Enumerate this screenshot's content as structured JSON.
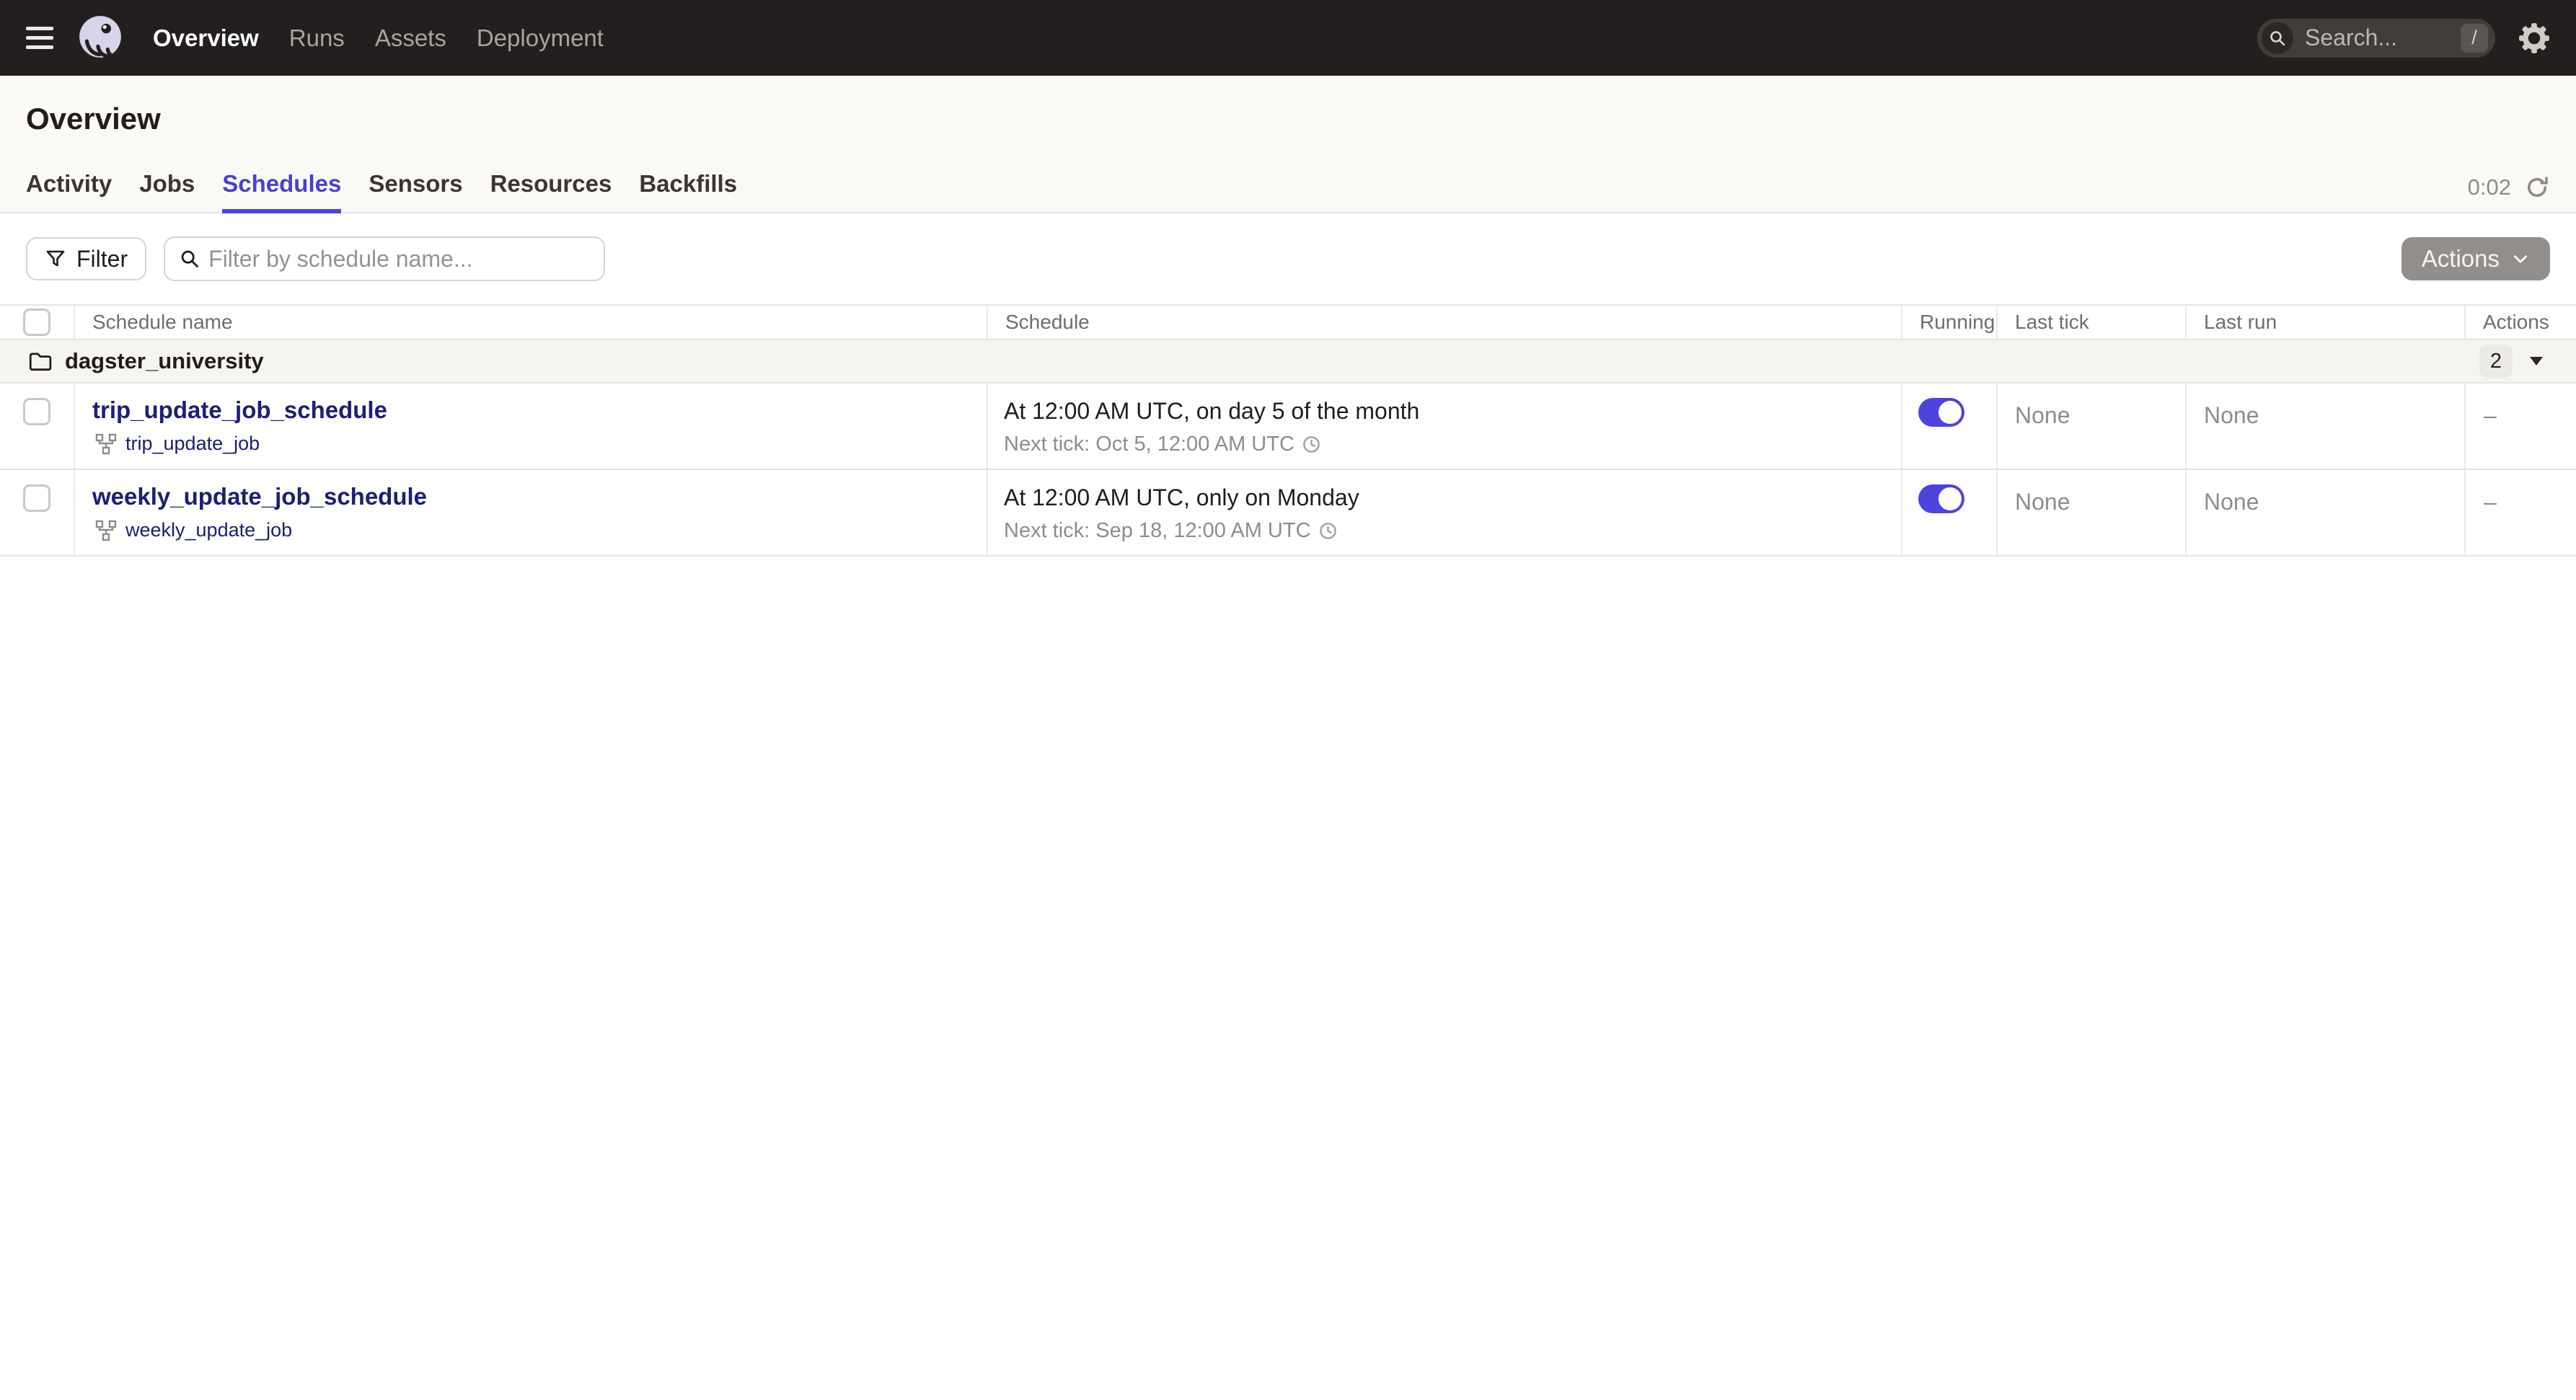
{
  "topbar": {
    "nav": [
      {
        "label": "Overview",
        "active": true
      },
      {
        "label": "Runs",
        "active": false
      },
      {
        "label": "Assets",
        "active": false
      },
      {
        "label": "Deployment",
        "active": false
      }
    ],
    "search": {
      "placeholder": "Search...",
      "shortcut": "/"
    }
  },
  "page": {
    "title": "Overview"
  },
  "tabs": [
    {
      "label": "Activity",
      "active": false
    },
    {
      "label": "Jobs",
      "active": false
    },
    {
      "label": "Schedules",
      "active": true
    },
    {
      "label": "Sensors",
      "active": false
    },
    {
      "label": "Resources",
      "active": false
    },
    {
      "label": "Backfills",
      "active": false
    }
  ],
  "refresh": {
    "countdown": "0:02"
  },
  "toolbar": {
    "filter_label": "Filter",
    "filter_placeholder": "Filter by schedule name...",
    "actions_label": "Actions"
  },
  "table": {
    "columns": [
      "Schedule name",
      "Schedule",
      "Running",
      "Last tick",
      "Last run",
      "Actions"
    ],
    "group": {
      "name": "dagster_university",
      "count": "2"
    },
    "rows": [
      {
        "name": "trip_update_job_schedule",
        "job": "trip_update_job",
        "cron": "At 12:00 AM UTC, on day 5 of the month",
        "next_tick": "Next tick: Oct 5, 12:00 AM UTC",
        "running": true,
        "last_tick": "None",
        "last_run": "None",
        "actions": "–"
      },
      {
        "name": "weekly_update_job_schedule",
        "job": "weekly_update_job",
        "cron": "At 12:00 AM UTC, only on Monday",
        "next_tick": "Next tick: Sep 18, 12:00 AM UTC",
        "running": true,
        "last_tick": "None",
        "last_run": "None",
        "actions": "–"
      }
    ]
  },
  "colors": {
    "topbar_bg": "#231F1E",
    "accent_blurple": "#4F43DD",
    "link_navy": "#1D2073",
    "muted_text": "#908D89",
    "pagehead_bg": "#FAF9F6",
    "group_row_bg": "#F5F4F1",
    "border": "#E6E4E1"
  },
  "icons": {
    "menu": "hamburger",
    "logo": "dagster-octopus",
    "search": "magnifier",
    "settings": "gear",
    "refresh": "circular-arrow",
    "filter": "funnel",
    "folder": "folder-outline",
    "job": "sitemap",
    "clock": "clock-face",
    "expand": "caret-down"
  }
}
